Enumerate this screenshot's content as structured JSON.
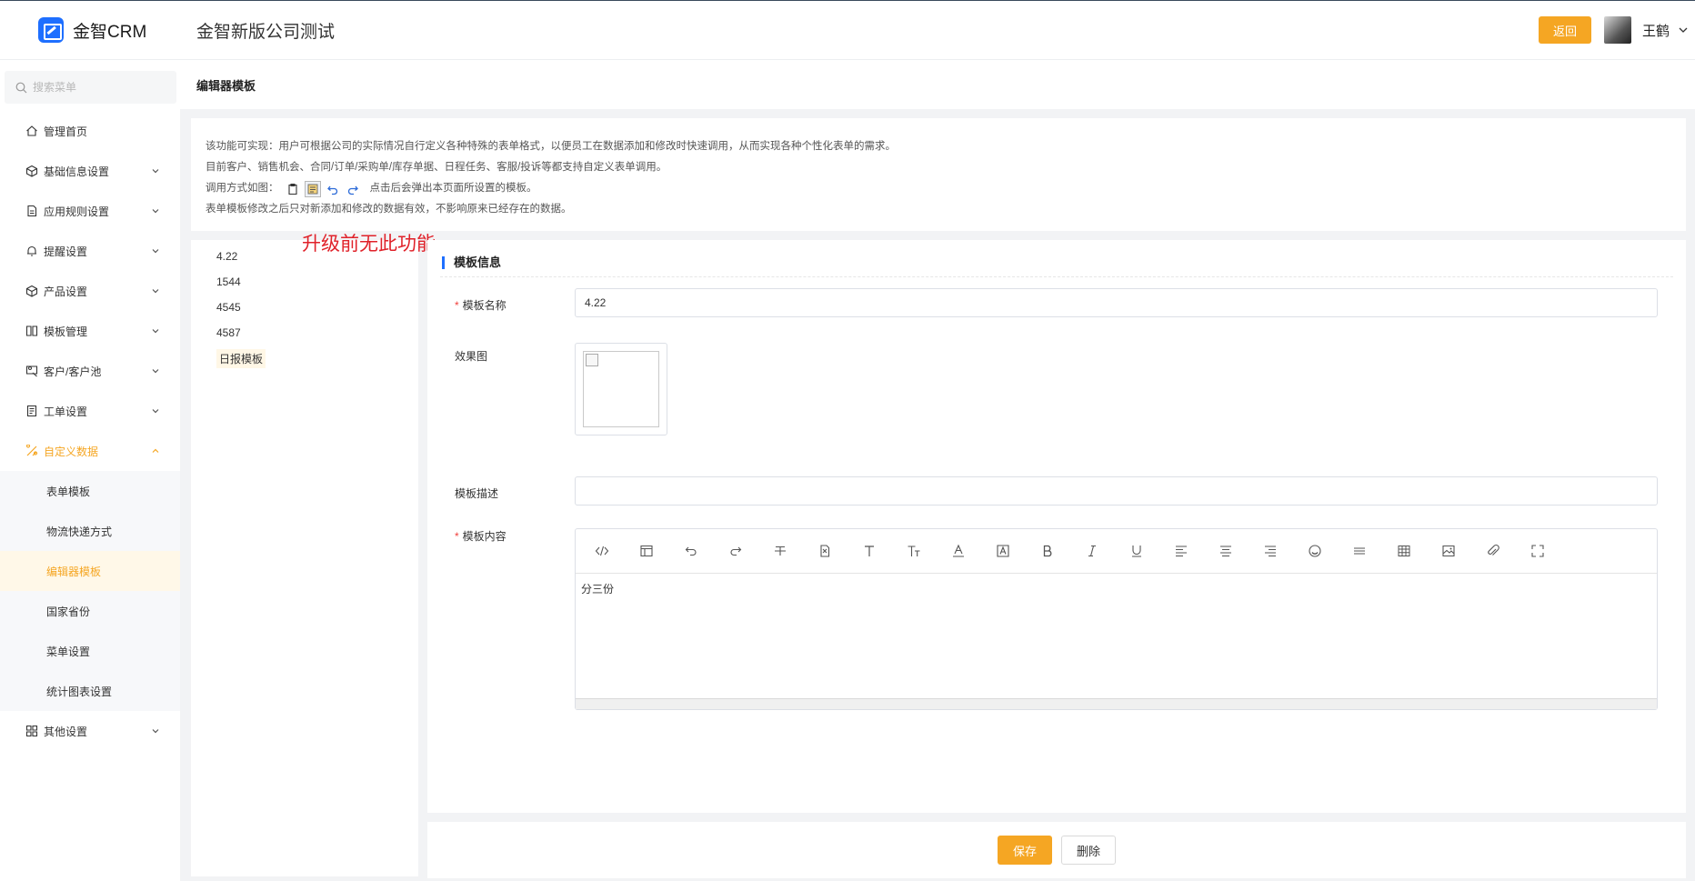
{
  "header": {
    "logo_text": "金智CRM",
    "company": "金智新版公司测试",
    "back_label": "返回",
    "user_name": "王鹤",
    "accent": "#f5a623",
    "brand": "#1e6fff"
  },
  "sidebar": {
    "search_placeholder": "搜索菜单",
    "items": [
      {
        "label": "管理首页",
        "icon": "home-icon"
      },
      {
        "label": "基础信息设置",
        "icon": "cube-icon"
      },
      {
        "label": "应用规则设置",
        "icon": "document-icon"
      },
      {
        "label": "提醒设置",
        "icon": "bell-icon"
      },
      {
        "label": "产品设置",
        "icon": "cube-icon"
      },
      {
        "label": "模板管理",
        "icon": "template-icon"
      },
      {
        "label": "客户/客户池",
        "icon": "customer-icon"
      },
      {
        "label": "工单设置",
        "icon": "ticket-icon"
      },
      {
        "label": "自定义数据",
        "icon": "custom-data-icon"
      },
      {
        "label": "其他设置",
        "icon": "grid-icon"
      }
    ],
    "sub_items": [
      {
        "label": "表单模板"
      },
      {
        "label": "物流快递方式"
      },
      {
        "label": "编辑器模板"
      },
      {
        "label": "国家省份"
      },
      {
        "label": "菜单设置"
      },
      {
        "label": "统计图表设置"
      }
    ]
  },
  "page": {
    "breadcrumb": "编辑器模板",
    "notice": {
      "line1": "该功能可实现：用户可根据公司的实际情况自行定义各种特殊的表单格式，以便员工在数据添加和修改时快速调用，从而实现各种个性化表单的需求。",
      "line2": "目前客户、销售机会、合同/订单/采购单/库存单据、日程任务、客服/投诉等都支持自定义表单调用。",
      "line3_prefix": "调用方式如图：",
      "line3_suffix": "点击后会弹出本页面所设置的模板。",
      "line4": "表单模板修改之后只对新添加和修改的数据有效，不影响原来已经存在的数据。"
    },
    "annotation": "升级前无此功能",
    "templates": [
      "4.22",
      "1544",
      "4545",
      "4587",
      "日报模板"
    ],
    "form": {
      "section_title": "模板信息",
      "name_label": "模板名称",
      "name_value": "4.22",
      "image_label": "效果图",
      "desc_label": "模板描述",
      "desc_value": "",
      "content_label": "模板内容",
      "content_value": "分三份"
    },
    "save_label": "保存",
    "delete_label": "删除"
  }
}
